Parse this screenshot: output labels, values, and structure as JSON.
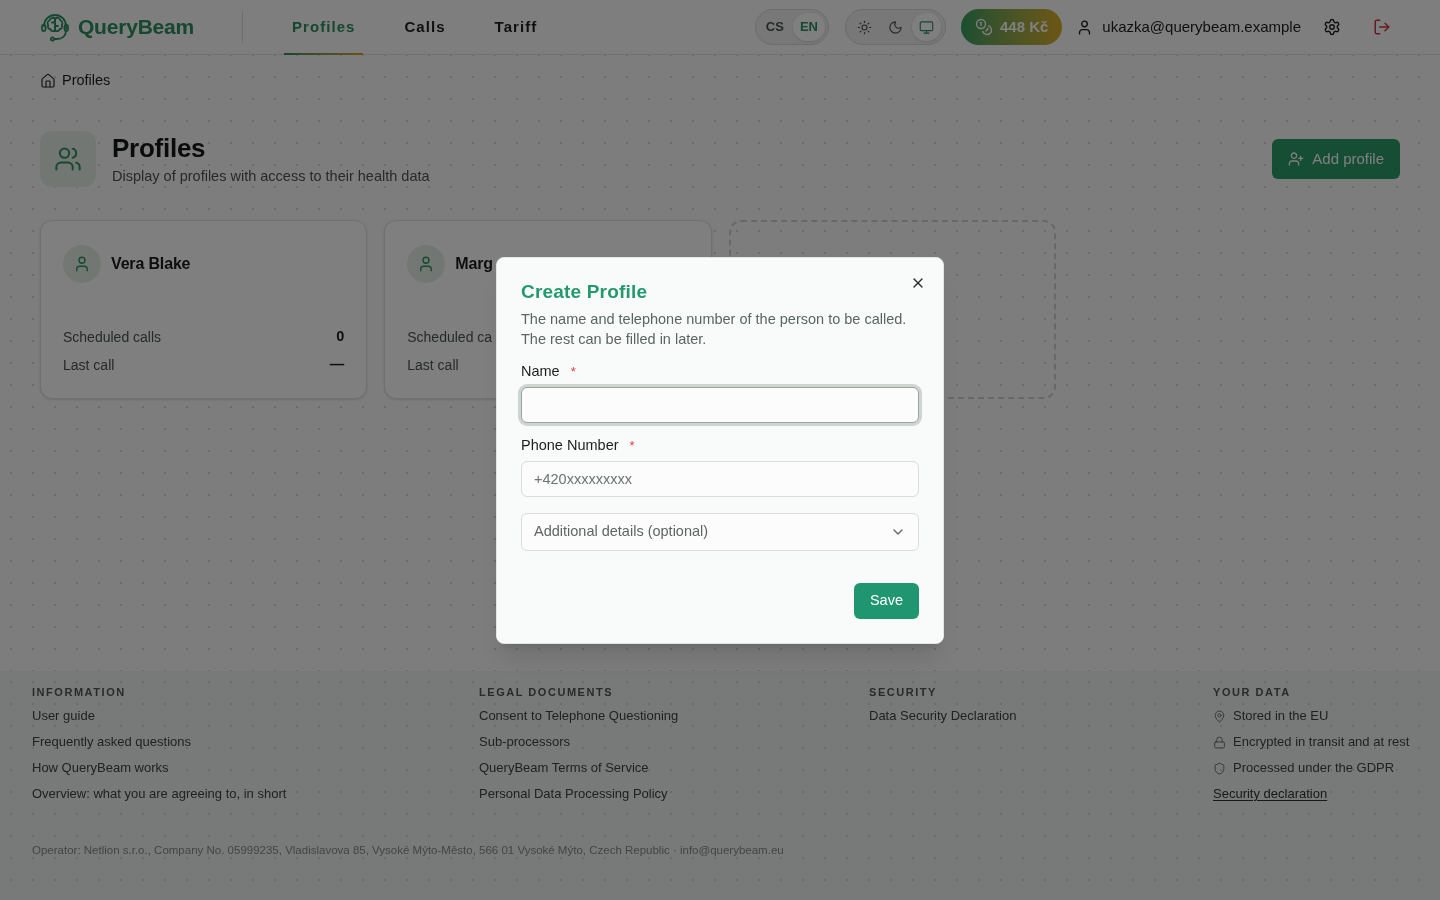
{
  "header": {
    "logo": "QueryBeam",
    "nav": [
      {
        "label": "Profiles",
        "selected": true
      },
      {
        "label": "Calls",
        "selected": false
      },
      {
        "label": "Tariff",
        "selected": false
      }
    ],
    "languages": [
      {
        "label": "CS",
        "selected": false
      },
      {
        "label": "EN",
        "selected": true
      }
    ],
    "theme_modes": [
      {
        "selected": false
      },
      {
        "selected": false
      },
      {
        "selected": true
      }
    ],
    "credit": "448 Kč",
    "user_email": "ukazka@querybeam.example"
  },
  "breadcrumb": [
    "Profiles"
  ],
  "page": {
    "title": "Profiles",
    "subtitle": "Display of profiles with access to their health data",
    "add_button": "Add profile"
  },
  "profiles": [
    {
      "kind": "profile",
      "name": "Vera Blake",
      "stats": [
        {
          "label": "Scheduled calls",
          "value": "0"
        },
        {
          "label": "Last call",
          "value": "—"
        }
      ]
    },
    {
      "kind": "profile",
      "name": "Marg",
      "stats": [
        {
          "label": "Scheduled ca"
        },
        {
          "label": "Last call"
        }
      ]
    },
    {
      "kind": "placeholder"
    }
  ],
  "dialog": {
    "title": "Create Profile",
    "description": "The name and telephone number of the person to be called. The rest can be filled in later.",
    "fields": [
      {
        "label": "Name",
        "required_mark": "*",
        "focused": true
      },
      {
        "label": "Phone Number",
        "required_mark": "*",
        "placeholder": "+420xxxxxxxxx",
        "focused": false
      }
    ],
    "details": {
      "label": "Additional details (optional)",
      "expanded": false
    },
    "submit": "Save"
  },
  "footer": {
    "columns": [
      {
        "heading": "INFORMATION",
        "links": [
          "User guide",
          "Frequently asked questions",
          "How QueryBeam works",
          "Overview: what you are agreeing to, in short"
        ]
      },
      {
        "heading": "LEGAL DOCUMENTS",
        "links": [
          "Consent to Telephone Questioning",
          "Sub-processors",
          "QueryBeam Terms of Service",
          "Personal Data Processing Policy"
        ]
      },
      {
        "heading": "SECURITY",
        "links": [
          "Data Security Declaration"
        ]
      },
      {
        "heading": "YOUR DATA",
        "facts": [
          "Stored in the EU",
          "Encrypted in transit and at rest",
          "Processed under the GDPR"
        ],
        "link": "Security declaration"
      }
    ],
    "operator": "Operator: Netlion s.r.o., Company No. 05999235, Vladislavova 85, Vysoké Mýto-Město, 566 01 Vysoké Mýto, Czech Republic · info@querybeam.eu"
  }
}
